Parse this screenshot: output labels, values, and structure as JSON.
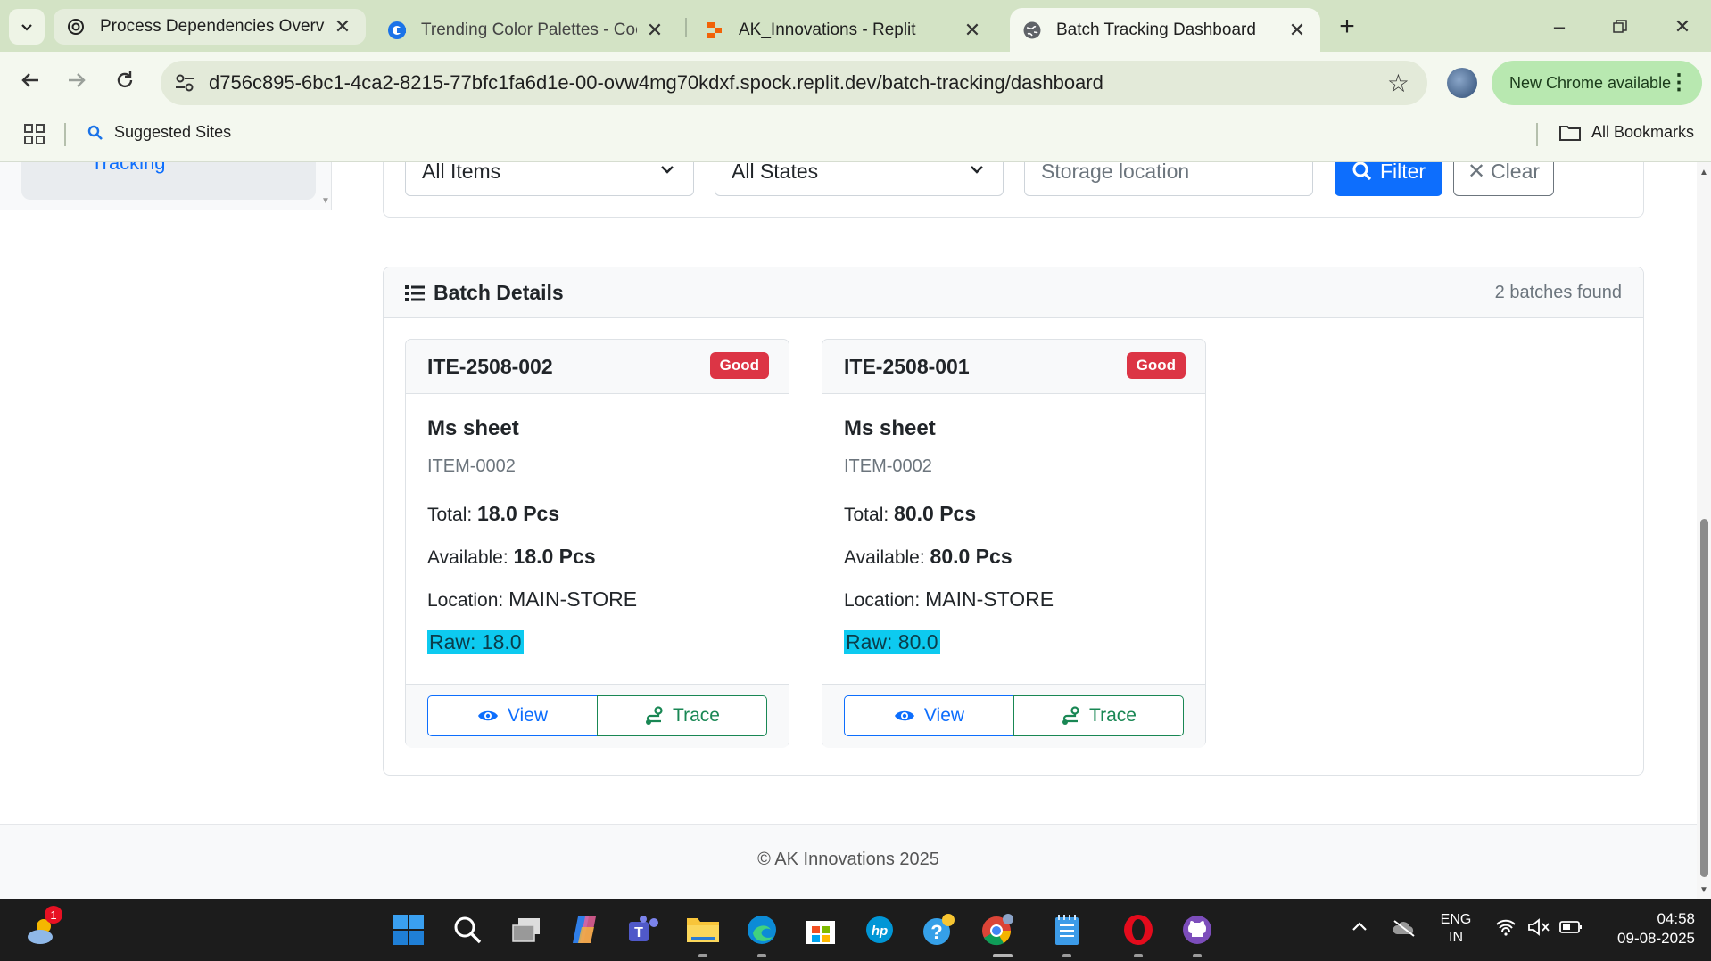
{
  "browser": {
    "tabs": [
      {
        "title": "Process Dependencies Overview",
        "icon": "openai-icon"
      },
      {
        "title": "Trending Color Palettes - Coolors",
        "icon": "coolors-icon"
      },
      {
        "title": "AK_Innovations - Replit",
        "icon": "replit-icon"
      },
      {
        "title": "Batch Tracking Dashboard",
        "icon": "globe-icon",
        "active": true
      }
    ],
    "url": "d756c895-6bc1-4ca2-8215-77bfc1fa6d1e-00-ovw4mg70kdxf.spock.replit.dev/batch-tracking/dashboard",
    "update_label": "New Chrome available",
    "bookmarks": {
      "suggested": "Suggested Sites",
      "all": "All Bookmarks"
    }
  },
  "sidebar": {
    "active_item_label": "Tracking"
  },
  "filters": {
    "item_select": "All Items",
    "state_select": "All States",
    "location_placeholder": "Storage location",
    "filter_button": "Filter",
    "clear_button": "Clear"
  },
  "batch_details": {
    "title": "Batch Details",
    "count_label": "2 batches found",
    "batches": [
      {
        "code": "ITE-2508-002",
        "status": "Good",
        "name": "Ms sheet",
        "item_code": "ITEM-0002",
        "total_label": "Total:",
        "total": "18.0 Pcs",
        "available_label": "Available:",
        "available": "18.0 Pcs",
        "location_label": "Location:",
        "location": "MAIN-STORE",
        "raw": "Raw: 18.0",
        "view_label": "View",
        "trace_label": "Trace"
      },
      {
        "code": "ITE-2508-001",
        "status": "Good",
        "name": "Ms sheet",
        "item_code": "ITEM-0002",
        "total_label": "Total:",
        "total": "80.0 Pcs",
        "available_label": "Available:",
        "available": "80.0 Pcs",
        "location_label": "Location:",
        "location": "MAIN-STORE",
        "raw": "Raw: 80.0",
        "view_label": "View",
        "trace_label": "Trace"
      }
    ]
  },
  "footer": {
    "copyright": "© AK Innovations 2025"
  },
  "taskbar": {
    "weather_badge": "1",
    "language": "ENG",
    "region": "IN",
    "time": "04:58",
    "date": "09-08-2025"
  },
  "colors": {
    "primary": "#0d6efd",
    "success": "#198754",
    "danger": "#dc3545",
    "info": "#0dcaf0",
    "tabstrip": "#d3e3c5",
    "toolbar": "#f4f8ef"
  }
}
